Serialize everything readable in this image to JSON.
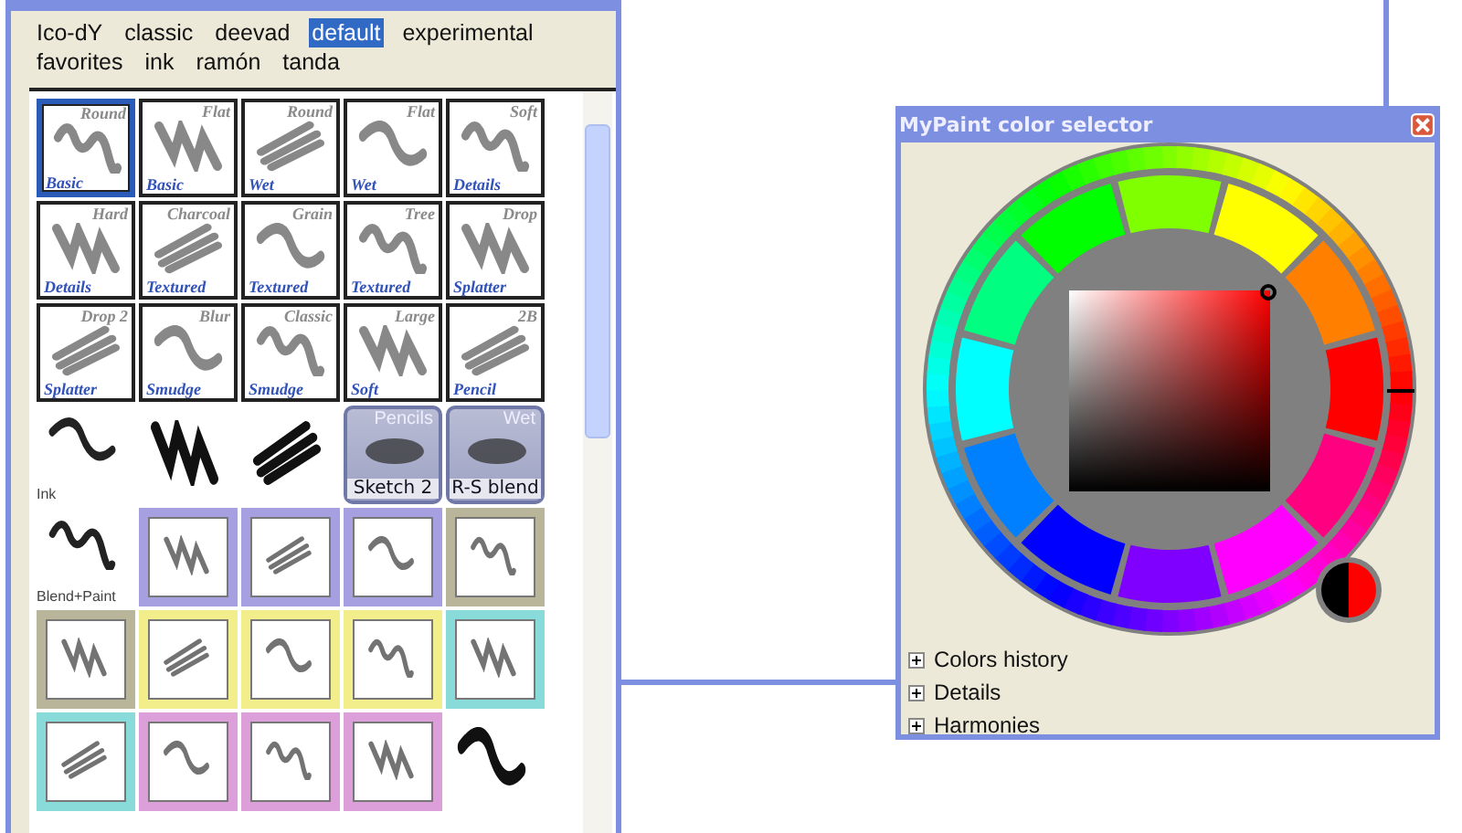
{
  "brush_window": {
    "groups": [
      {
        "label": "Ico-dY",
        "selected": false
      },
      {
        "label": "classic",
        "selected": false
      },
      {
        "label": "deevad",
        "selected": false
      },
      {
        "label": "default",
        "selected": true
      },
      {
        "label": "experimental",
        "selected": false
      },
      {
        "label": "favorites",
        "selected": false
      },
      {
        "label": "ink",
        "selected": false
      },
      {
        "label": "ramón",
        "selected": false
      },
      {
        "label": "tanda",
        "selected": false
      }
    ],
    "brushes": [
      {
        "kind": "labeled",
        "top": "Round",
        "bottom": "Basic",
        "selected": true
      },
      {
        "kind": "labeled",
        "top": "Flat",
        "bottom": "Basic",
        "selected": false
      },
      {
        "kind": "labeled",
        "top": "Round",
        "bottom": "Wet",
        "selected": false
      },
      {
        "kind": "labeled",
        "top": "Flat",
        "bottom": "Wet",
        "selected": false
      },
      {
        "kind": "labeled",
        "top": "Soft",
        "bottom": "Details",
        "selected": false
      },
      {
        "kind": "labeled",
        "top": "Hard",
        "bottom": "Details",
        "selected": false
      },
      {
        "kind": "labeled",
        "top": "Charcoal",
        "bottom": "Textured",
        "selected": false
      },
      {
        "kind": "labeled",
        "top": "Grain",
        "bottom": "Textured",
        "selected": false
      },
      {
        "kind": "labeled",
        "top": "Tree",
        "bottom": "Textured",
        "selected": false
      },
      {
        "kind": "labeled",
        "top": "Drop",
        "bottom": "Splatter",
        "selected": false
      },
      {
        "kind": "labeled",
        "top": "Drop 2",
        "bottom": "Splatter",
        "selected": false
      },
      {
        "kind": "labeled",
        "top": "Blur",
        "bottom": "Smudge",
        "selected": false
      },
      {
        "kind": "labeled",
        "top": "Classic",
        "bottom": "Smudge",
        "selected": false
      },
      {
        "kind": "labeled",
        "top": "Large",
        "bottom": "Soft",
        "selected": false
      },
      {
        "kind": "labeled",
        "top": "2B",
        "bottom": "Pencil",
        "selected": false
      },
      {
        "kind": "caption",
        "caption": "Ink",
        "selected": false
      },
      {
        "kind": "plain",
        "selected": false
      },
      {
        "kind": "plain",
        "selected": false
      },
      {
        "kind": "badge",
        "top": "Pencils",
        "bottom": "Sketch 2",
        "selected": false
      },
      {
        "kind": "badge",
        "top": "Wet",
        "bottom": "R-S blend",
        "selected": false
      },
      {
        "kind": "caption",
        "caption": "Blend+Paint",
        "selected": false
      },
      {
        "kind": "framed",
        "color": "#a69fe0",
        "selected": false
      },
      {
        "kind": "framed",
        "color": "#a69fe0",
        "selected": false
      },
      {
        "kind": "framed",
        "color": "#a69fe0",
        "selected": false
      },
      {
        "kind": "framed",
        "color": "#b8b59a",
        "selected": false
      },
      {
        "kind": "framed",
        "color": "#b8b59a",
        "selected": false
      },
      {
        "kind": "framed",
        "color": "#f2ee8c",
        "selected": false
      },
      {
        "kind": "framed",
        "color": "#f2ee8c",
        "selected": false
      },
      {
        "kind": "framed",
        "color": "#f2ee8c",
        "selected": false
      },
      {
        "kind": "framed",
        "color": "#88dbd8",
        "selected": false
      },
      {
        "kind": "framed",
        "color": "#88dbd8",
        "selected": false
      },
      {
        "kind": "framed",
        "color": "#dc9fd9",
        "selected": false
      },
      {
        "kind": "framed",
        "color": "#dc9fd9",
        "selected": false
      },
      {
        "kind": "framed",
        "color": "#dc9fd9",
        "selected": false
      },
      {
        "kind": "plain",
        "selected": false
      }
    ]
  },
  "color_selector": {
    "title": "MyPaint color selector",
    "swatches": [
      {
        "color": "#80ff00"
      },
      {
        "color": "#ffff00"
      },
      {
        "color": "#ff8000"
      },
      {
        "color": "#ff0000"
      },
      {
        "color": "#ff0080"
      },
      {
        "color": "#ff00ff"
      },
      {
        "color": "#8000ff"
      },
      {
        "color": "#0000ff"
      },
      {
        "color": "#0080ff"
      },
      {
        "color": "#00ffff"
      },
      {
        "color": "#00ff80"
      },
      {
        "color": "#00ff00"
      }
    ],
    "comparison": [
      {
        "color": "#000000"
      },
      {
        "color": "#ff0000"
      }
    ],
    "sections": [
      {
        "label": "Colors history",
        "expanded": false
      },
      {
        "label": "Details",
        "expanded": false
      },
      {
        "label": "Harmonies",
        "expanded": false
      }
    ]
  }
}
